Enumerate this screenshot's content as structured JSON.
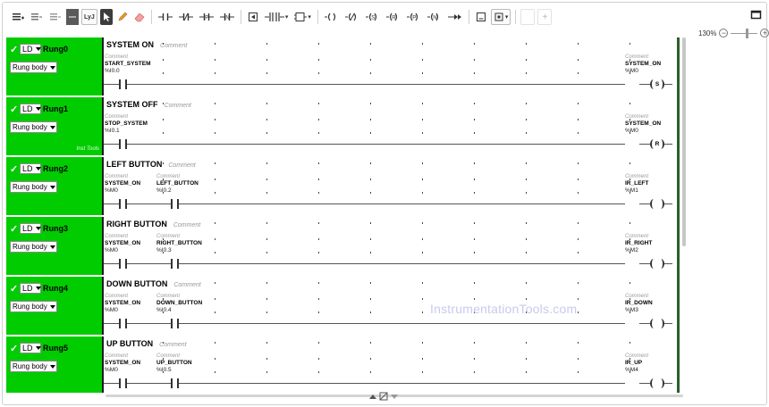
{
  "toolbar": {
    "buttons": [
      {
        "name": "insert-rung-icon",
        "glyph": "≡"
      },
      {
        "name": "insert-branch-icon",
        "glyph": "⊞"
      },
      {
        "name": "insert-element-icon",
        "glyph": "⊡"
      },
      {
        "name": "ladder-mode-icon",
        "glyph": ""
      },
      {
        "name": "lyj-mode-button",
        "glyph": "LyJ"
      },
      {
        "name": "pointer-tool-icon",
        "glyph": "➤"
      },
      {
        "name": "pencil-tool-icon",
        "glyph": "✎"
      },
      {
        "name": "eraser-tool-icon",
        "glyph": "⌫"
      },
      {
        "name": "no-contact-icon",
        "glyph": "⊣⊢"
      },
      {
        "name": "nc-contact-icon",
        "glyph": "⊣/⊢"
      },
      {
        "name": "p-contact-icon",
        "glyph": "⊣P⊢"
      },
      {
        "name": "n-contact-icon",
        "glyph": "⊣N⊢"
      },
      {
        "name": "timer-block-icon",
        "glyph": "⊟"
      },
      {
        "name": "parallel-branch-icon",
        "glyph": "⫲"
      },
      {
        "name": "function-block-icon",
        "glyph": "⊏"
      },
      {
        "name": "coil-icon",
        "glyph": "-( )"
      },
      {
        "name": "neg-coil-icon",
        "glyph": "-(/)"
      },
      {
        "name": "set-coil-icon",
        "glyph": "-(S)"
      },
      {
        "name": "reset-coil-icon",
        "glyph": "-(R)"
      },
      {
        "name": "p-coil-icon",
        "glyph": "-(P)"
      },
      {
        "name": "n-coil-icon",
        "glyph": "-(N)"
      },
      {
        "name": "jump-icon",
        "glyph": "->>"
      },
      {
        "name": "operate-block-icon",
        "glyph": "⊡"
      },
      {
        "name": "compare-block-icon",
        "glyph": "⊡"
      },
      {
        "name": "disabled-tool-1-icon",
        "glyph": ""
      },
      {
        "name": "add-tool-icon",
        "glyph": "+"
      }
    ]
  },
  "zoom": {
    "level": "130%"
  },
  "common": {
    "comment_placeholder": "Comment",
    "lang": "LD",
    "rung_body": "Rung body",
    "tools_note": "Inst Tools"
  },
  "rungs": [
    {
      "name": "Rung0",
      "title": "SYSTEM ON",
      "contacts": [
        {
          "var": "START_SYSTEM",
          "addr": "%I0.0"
        }
      ],
      "coil": {
        "var": "SYSTEM_ON",
        "addr": "%M0",
        "type": "S"
      }
    },
    {
      "name": "Rung1",
      "title": "SYSTEM OFF",
      "contacts": [
        {
          "var": "STOP_SYSTEM",
          "addr": "%I0.1"
        }
      ],
      "coil": {
        "var": "SYSTEM_ON",
        "addr": "%M0",
        "type": "R"
      }
    },
    {
      "name": "Rung2",
      "title": "LEFT BUTTON",
      "contacts": [
        {
          "var": "SYSTEM_ON",
          "addr": "%M0"
        },
        {
          "var": "LEFT_BUTTON",
          "addr": "%I0.2"
        }
      ],
      "coil": {
        "var": "IR_LEFT",
        "addr": "%M1",
        "type": ""
      }
    },
    {
      "name": "Rung3",
      "title": "RIGHT BUTTON",
      "contacts": [
        {
          "var": "SYSTEM_ON",
          "addr": "%M0"
        },
        {
          "var": "RIGHT_BUTTON",
          "addr": "%I0.3"
        }
      ],
      "coil": {
        "var": "IR_RIGHT",
        "addr": "%M2",
        "type": ""
      }
    },
    {
      "name": "Rung4",
      "title": "DOWN BUTTON",
      "contacts": [
        {
          "var": "SYSTEM_ON",
          "addr": "%M0"
        },
        {
          "var": "DOWN_BUTTON",
          "addr": "%I0.4"
        }
      ],
      "coil": {
        "var": "IR_DOWN",
        "addr": "%M3",
        "type": ""
      }
    },
    {
      "name": "Rung5",
      "title": "UP BUTTON",
      "contacts": [
        {
          "var": "SYSTEM_ON",
          "addr": "%M0"
        },
        {
          "var": "UP_BUTTON",
          "addr": "%I0.5"
        }
      ],
      "coil": {
        "var": "IR_UP",
        "addr": "%M4",
        "type": ""
      }
    }
  ],
  "watermark": "InstrumentationTools.com"
}
